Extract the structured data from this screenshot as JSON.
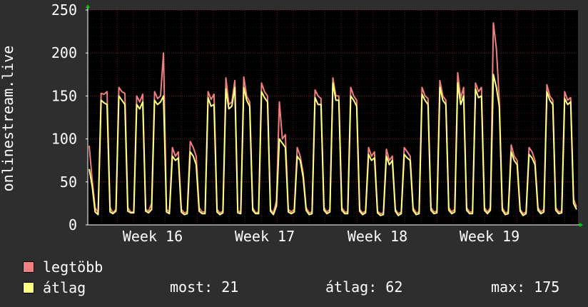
{
  "chart_data": {
    "type": "line",
    "ylabel": "onlinestream.live",
    "ylim": [
      0,
      250
    ],
    "y_ticks": [
      "0",
      "50",
      "100",
      "150",
      "200",
      "250"
    ],
    "x_ticks": [
      "Week 16",
      "Week 17",
      "Week 18",
      "Week 19"
    ],
    "grid": true,
    "series": [
      {
        "name": "legtöbb",
        "color": "#f07f7f",
        "values": [
          92,
          52,
          20,
          14,
          153,
          152,
          155,
          20,
          14,
          18,
          160,
          155,
          153,
          20,
          15,
          15,
          150,
          143,
          152,
          18,
          16,
          25,
          155,
          147,
          150,
          200,
          18,
          15,
          90,
          80,
          85,
          18,
          14,
          15,
          97,
          90,
          80,
          20,
          15,
          15,
          155,
          146,
          152,
          18,
          14,
          16,
          171,
          140,
          143,
          168,
          16,
          15,
          172,
          150,
          143,
          20,
          14,
          15,
          165,
          155,
          150,
          18,
          14,
          28,
          143,
          100,
          105,
          18,
          15,
          18,
          90,
          80,
          60,
          20,
          14,
          15,
          157,
          150,
          147,
          20,
          15,
          18,
          171,
          150,
          150,
          20,
          15,
          15,
          160,
          150,
          145,
          18,
          14,
          16,
          90,
          80,
          85,
          16,
          13,
          14,
          88,
          75,
          80,
          18,
          13,
          15,
          90,
          85,
          80,
          20,
          14,
          15,
          160,
          150,
          147,
          20,
          15,
          16,
          168,
          150,
          145,
          20,
          15,
          18,
          177,
          147,
          160,
          20,
          15,
          15,
          165,
          155,
          160,
          20,
          15,
          20,
          235,
          205,
          145,
          20,
          14,
          15,
          93,
          80,
          75,
          18,
          13,
          15,
          90,
          85,
          75,
          20,
          15,
          18,
          163,
          150,
          145,
          20,
          15,
          16,
          155,
          145,
          148,
          30,
          21
        ]
      },
      {
        "name": "átlag",
        "color": "#ffff80",
        "values": [
          65,
          45,
          15,
          12,
          145,
          142,
          140,
          15,
          13,
          16,
          150,
          145,
          140,
          16,
          14,
          14,
          140,
          135,
          143,
          16,
          14,
          18,
          145,
          140,
          143,
          150,
          15,
          13,
          80,
          75,
          78,
          15,
          12,
          13,
          85,
          80,
          70,
          16,
          13,
          13,
          148,
          138,
          140,
          15,
          12,
          14,
          158,
          135,
          138,
          160,
          14,
          13,
          160,
          145,
          138,
          17,
          13,
          13,
          155,
          148,
          143,
          16,
          12,
          22,
          100,
          95,
          90,
          15,
          13,
          15,
          80,
          75,
          55,
          17,
          12,
          13,
          148,
          140,
          140,
          17,
          13,
          15,
          165,
          145,
          145,
          17,
          13,
          13,
          150,
          145,
          138,
          16,
          12,
          14,
          82,
          75,
          78,
          14,
          11,
          12,
          80,
          70,
          75,
          16,
          11,
          13,
          82,
          78,
          75,
          17,
          12,
          13,
          152,
          145,
          140,
          17,
          13,
          14,
          160,
          145,
          140,
          17,
          13,
          15,
          165,
          140,
          150,
          17,
          13,
          13,
          158,
          148,
          150,
          17,
          13,
          17,
          175,
          160,
          138,
          17,
          12,
          13,
          85,
          75,
          70,
          16,
          11,
          13,
          82,
          78,
          70,
          17,
          13,
          15,
          155,
          145,
          140,
          17,
          13,
          14,
          147,
          140,
          143,
          25,
          18
        ]
      }
    ],
    "legend": {
      "max_label": "legtöbb",
      "avg_label": "átlag"
    },
    "stats": {
      "now": "most: 21",
      "avg": "átlag: 62",
      "max": "max: 175"
    },
    "colors": {
      "background": "#2e2e2e",
      "plot_background": "#000000",
      "grid": "#5a1a1a",
      "axis_arrow": "#00cc00",
      "text": "#ffffff"
    }
  }
}
